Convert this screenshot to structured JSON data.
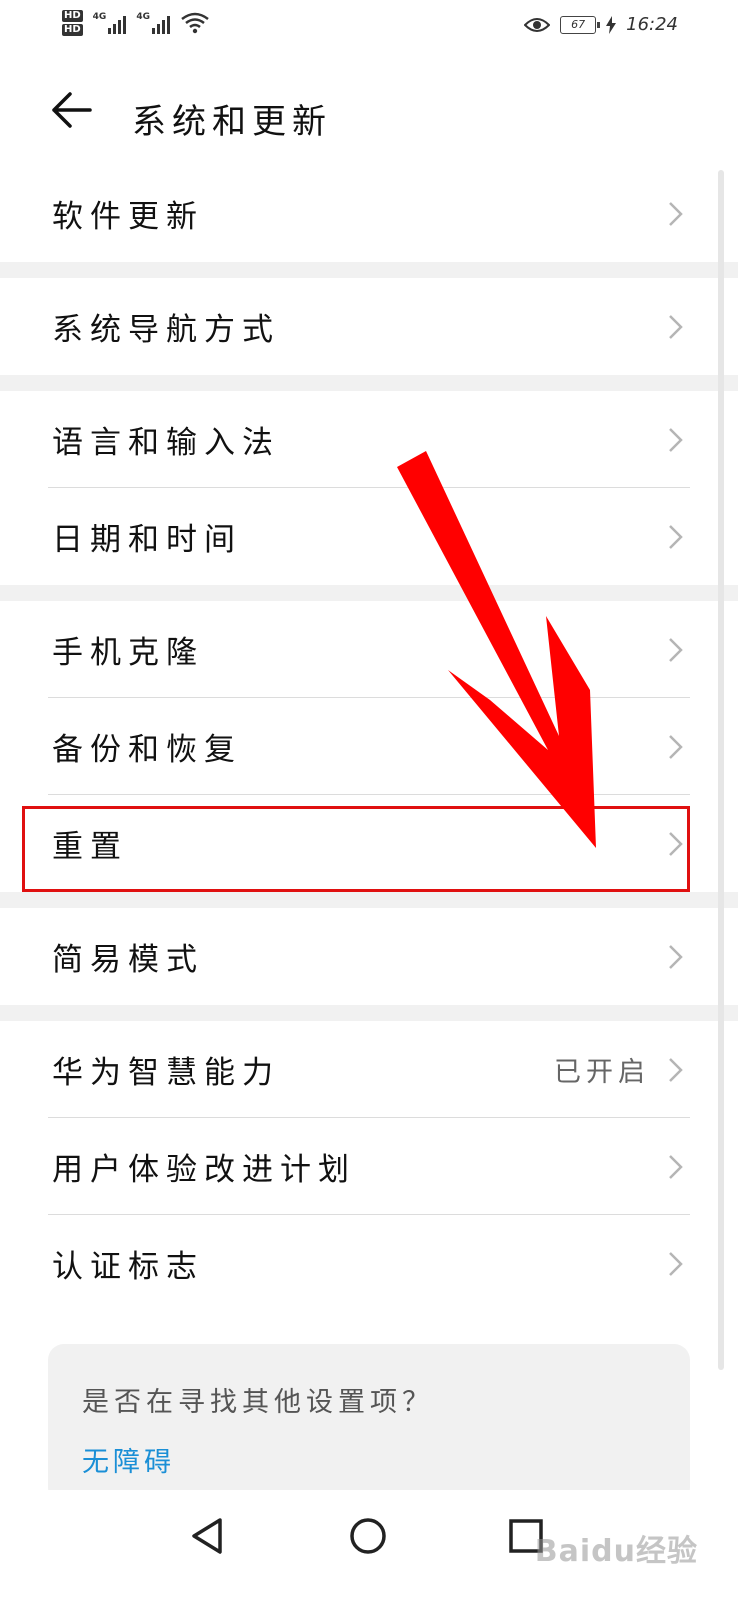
{
  "status_bar": {
    "hd1": "HD",
    "hd2": "HD",
    "sig1_label": "4G",
    "sig2_label": "4G",
    "battery": "67",
    "time": "16:24"
  },
  "header": {
    "title": "系统和更新"
  },
  "groups": [
    {
      "items": [
        {
          "label": "软件更新",
          "value": ""
        }
      ]
    },
    {
      "items": [
        {
          "label": "系统导航方式",
          "value": ""
        }
      ]
    },
    {
      "items": [
        {
          "label": "语言和输入法",
          "value": ""
        },
        {
          "label": "日期和时间",
          "value": ""
        }
      ]
    },
    {
      "items": [
        {
          "label": "手机克隆",
          "value": ""
        },
        {
          "label": "备份和恢复",
          "value": ""
        },
        {
          "label": "重置",
          "value": ""
        }
      ]
    },
    {
      "items": [
        {
          "label": "简易模式",
          "value": ""
        }
      ]
    },
    {
      "items": [
        {
          "label": "华为智慧能力",
          "value": "已开启"
        },
        {
          "label": "用户体验改进计划",
          "value": ""
        },
        {
          "label": "认证标志",
          "value": ""
        }
      ]
    }
  ],
  "suggest": {
    "title": "是否在寻找其他设置项？",
    "link": "无障碍"
  },
  "watermark": "Baidu经验",
  "colors": {
    "annotation_red": "#ff0000",
    "link_blue": "#1a8fd6",
    "group_gap": "#f1f1f1"
  },
  "icons": {
    "back": "back-arrow-icon",
    "chevron": "chevron-right-icon",
    "nav_back": "triangle-back-icon",
    "nav_home": "circle-home-icon",
    "nav_recents": "square-recents-icon"
  }
}
